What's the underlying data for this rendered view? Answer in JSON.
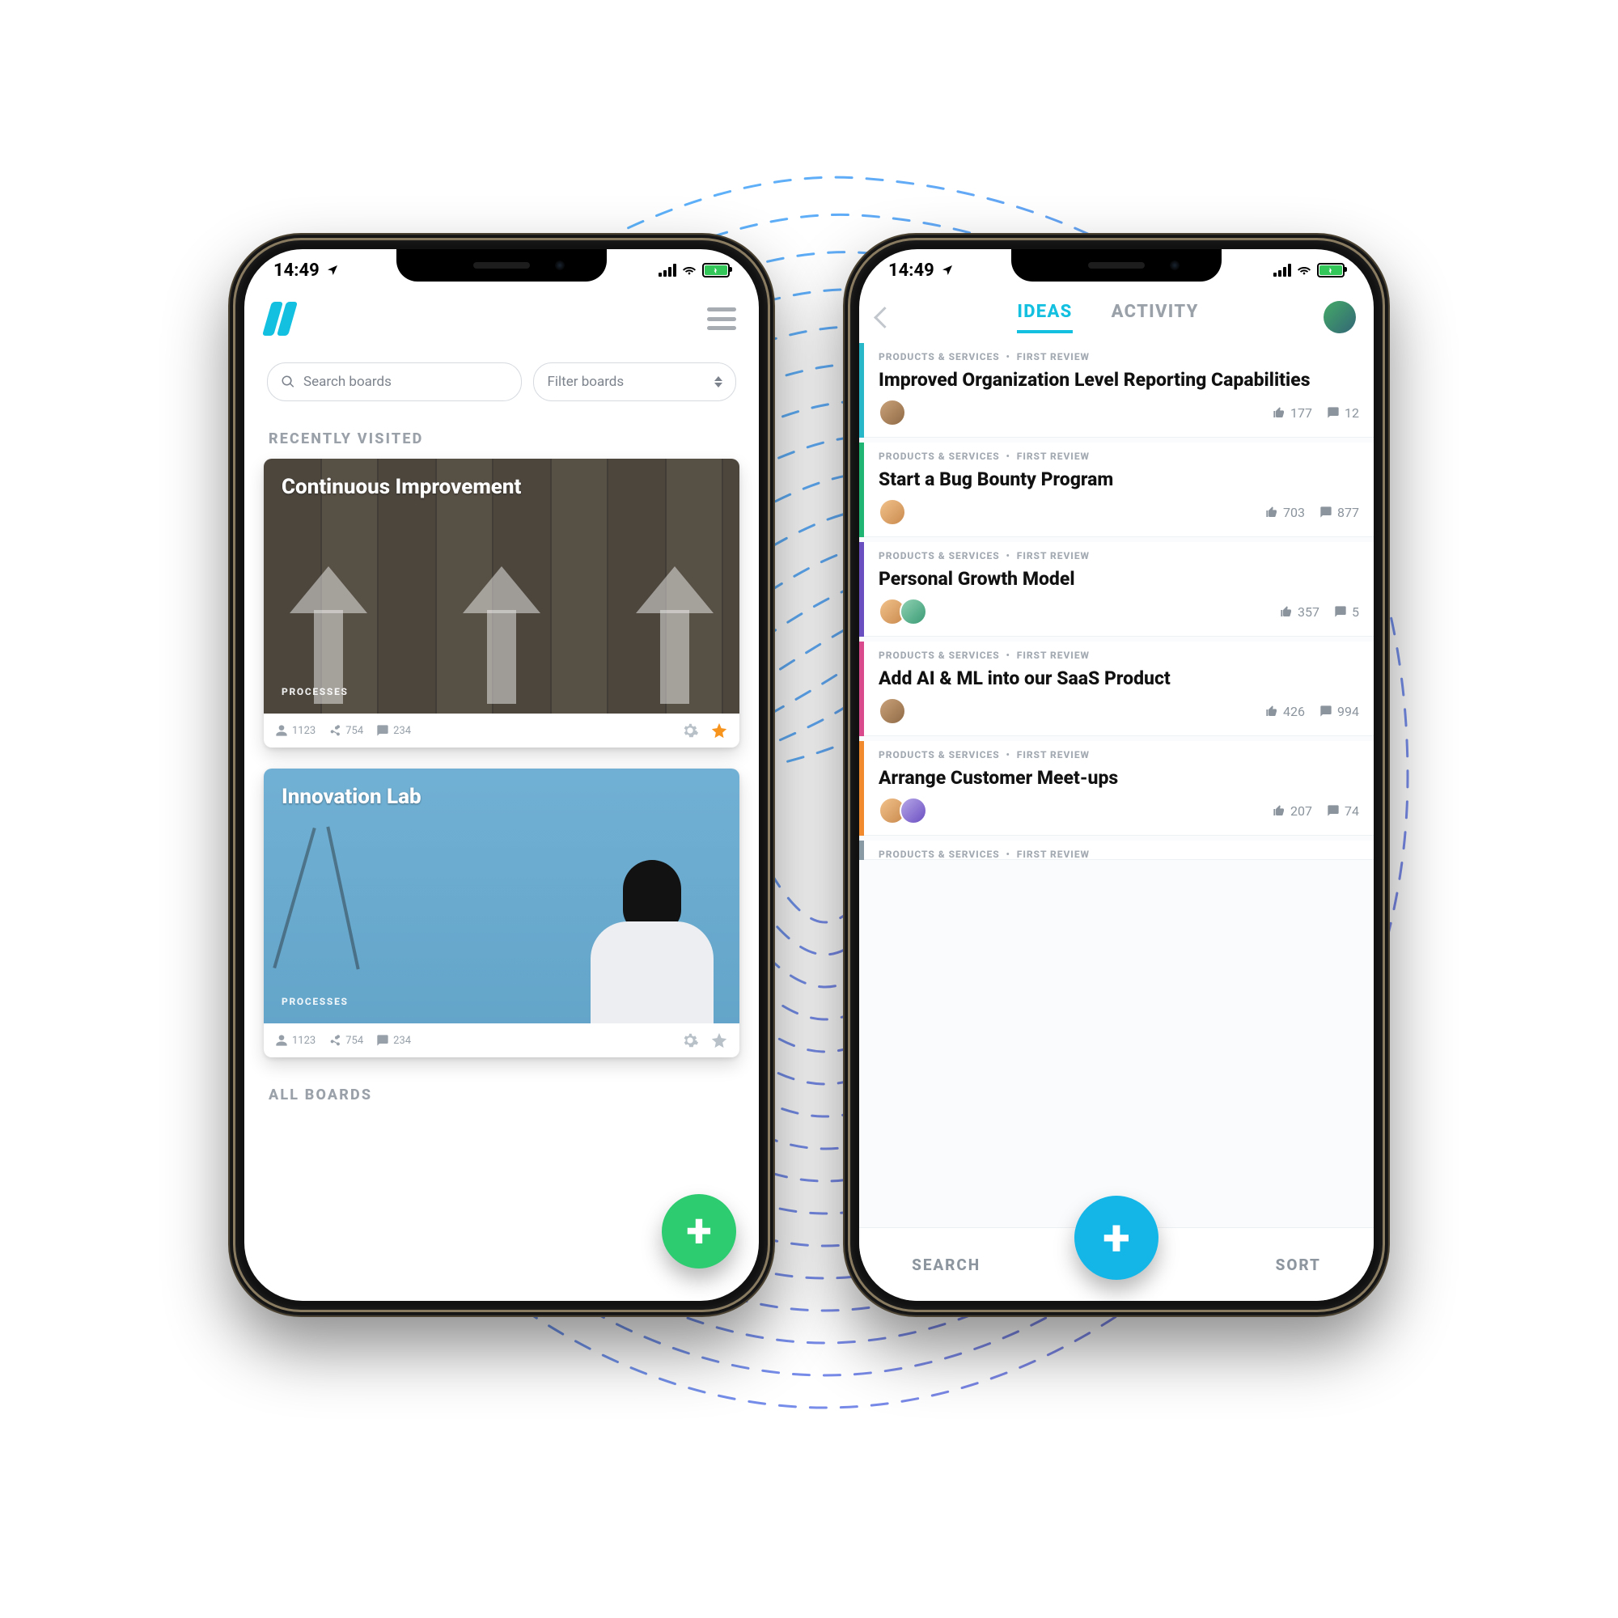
{
  "status_bar": {
    "time": "14:49",
    "location_arrow": "↗"
  },
  "phone1": {
    "search_placeholder": "Search boards",
    "filter_label": "Filter boards",
    "section_recently_visited": "RECENTLY VISITED",
    "section_all_boards": "ALL BOARDS",
    "boards": [
      {
        "title": "Continuous Improvement",
        "category": "PROCESSES",
        "members": "1123",
        "contributors": "754",
        "comments": "234",
        "starred": true
      },
      {
        "title": "Innovation Lab",
        "category": "PROCESSES",
        "members": "1123",
        "contributors": "754",
        "comments": "234",
        "starred": false
      }
    ]
  },
  "phone2": {
    "tabs": {
      "ideas": "IDEAS",
      "activity": "ACTIVITY"
    },
    "crumbs": {
      "category": "PRODUCTS & SERVICES",
      "sep": "•",
      "stage": "FIRST REVIEW"
    },
    "ideas": [
      {
        "title": "Improved Organization Level Reporting Capabilities",
        "likes": "177",
        "comments": "12",
        "color": "c-teal",
        "avs": [
          "c1"
        ]
      },
      {
        "title": "Start a Bug Bounty Program",
        "likes": "703",
        "comments": "877",
        "color": "c-green",
        "avs": [
          "c2"
        ]
      },
      {
        "title": "Personal Growth Model",
        "likes": "357",
        "comments": "5",
        "color": "c-purple",
        "avs": [
          "c2",
          "c3"
        ]
      },
      {
        "title": "Add AI & ML into our SaaS Product",
        "likes": "426",
        "comments": "994",
        "color": "c-pink",
        "avs": [
          "c1"
        ]
      },
      {
        "title": "Arrange Customer Meet-ups",
        "likes": "207",
        "comments": "74",
        "color": "c-orange",
        "avs": [
          "c2",
          "c4"
        ]
      }
    ],
    "bottom": {
      "search": "SEARCH",
      "sort": "SORT"
    }
  },
  "icons": {
    "plus": "+"
  }
}
